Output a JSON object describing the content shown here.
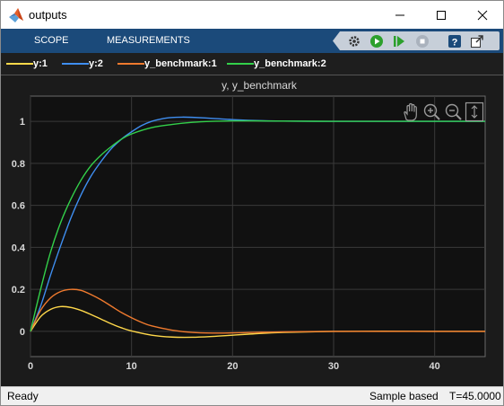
{
  "window": {
    "title": "outputs"
  },
  "toolstrip": {
    "tabs": [
      {
        "label": "SCOPE"
      },
      {
        "label": "MEASUREMENTS"
      }
    ],
    "quick_access": [
      "settings-icon",
      "run-icon",
      "step-forward-icon",
      "stop-icon",
      "help-icon",
      "undock-icon"
    ]
  },
  "legend": [
    {
      "label": "y:1",
      "color": "#ffd84a"
    },
    {
      "label": "y:2",
      "color": "#3f8ef0"
    },
    {
      "label": "y_benchmark:1",
      "color": "#ef7a2e"
    },
    {
      "label": "y_benchmark:2",
      "color": "#33d04a"
    }
  ],
  "plot_tools": [
    "pan-hand-icon",
    "zoom-in-icon",
    "zoom-out-icon",
    "autoscale-icon"
  ],
  "status": {
    "left": "Ready",
    "mode": "Sample based",
    "time": "T=45.0000"
  },
  "chart_data": {
    "type": "line",
    "title": "y, y_benchmark",
    "xlabel": "",
    "ylabel": "",
    "xlim": [
      0,
      45
    ],
    "ylim": [
      -0.12,
      1.12
    ],
    "x_ticks": [
      0,
      10,
      20,
      30,
      40
    ],
    "y_ticks": [
      0,
      0.2,
      0.4,
      0.6,
      0.8,
      1
    ],
    "y_tick_labels": [
      "0",
      "0.2",
      "0.4",
      "0.6",
      "0.8",
      "1"
    ],
    "grid": true,
    "legend_position": "top",
    "series": [
      {
        "name": "y:1",
        "color": "#ffd84a",
        "x": [
          0,
          1,
          2,
          3,
          4,
          5,
          6,
          7,
          8,
          9,
          10,
          12,
          14,
          16,
          18,
          20,
          22,
          25,
          30,
          35,
          40,
          45
        ],
        "y": [
          0,
          0.07,
          0.105,
          0.118,
          0.114,
          0.1,
          0.08,
          0.058,
          0.036,
          0.017,
          0.002,
          -0.018,
          -0.027,
          -0.028,
          -0.024,
          -0.018,
          -0.012,
          -0.005,
          0.0,
          0.001,
          0.0,
          0.0
        ]
      },
      {
        "name": "y:2",
        "color": "#3f8ef0",
        "x": [
          0,
          1,
          2,
          3,
          4,
          5,
          6,
          7,
          8,
          9,
          10,
          11,
          12,
          13,
          14,
          15,
          16,
          18,
          20,
          22,
          25,
          30,
          35,
          40,
          45
        ],
        "y": [
          0,
          0.12,
          0.27,
          0.41,
          0.54,
          0.65,
          0.74,
          0.81,
          0.87,
          0.915,
          0.95,
          0.98,
          1.0,
          1.012,
          1.018,
          1.02,
          1.019,
          1.014,
          1.008,
          1.004,
          1.001,
          1.0,
          1.0,
          1.0,
          1.0
        ]
      },
      {
        "name": "y_benchmark:1",
        "color": "#ef7a2e",
        "x": [
          0,
          1,
          2,
          3,
          4,
          5,
          6,
          7,
          8,
          9,
          10,
          11,
          12,
          14,
          16,
          18,
          20,
          22,
          25,
          30,
          35,
          40,
          45
        ],
        "y": [
          0,
          0.1,
          0.16,
          0.19,
          0.2,
          0.195,
          0.175,
          0.15,
          0.12,
          0.09,
          0.065,
          0.043,
          0.026,
          0.006,
          -0.005,
          -0.008,
          -0.007,
          -0.005,
          -0.002,
          0.0,
          0.0,
          0.0,
          0.0
        ]
      },
      {
        "name": "y_benchmark:2",
        "color": "#33d04a",
        "x": [
          0,
          1,
          2,
          3,
          4,
          5,
          6,
          7,
          8,
          9,
          10,
          12,
          14,
          16,
          18,
          20,
          22,
          25,
          30,
          35,
          40,
          45
        ],
        "y": [
          0,
          0.2,
          0.38,
          0.52,
          0.63,
          0.72,
          0.79,
          0.84,
          0.88,
          0.915,
          0.94,
          0.97,
          0.985,
          0.995,
          1.0,
          1.002,
          1.002,
          1.001,
          1.0,
          1.0,
          1.0,
          1.0
        ]
      }
    ]
  }
}
